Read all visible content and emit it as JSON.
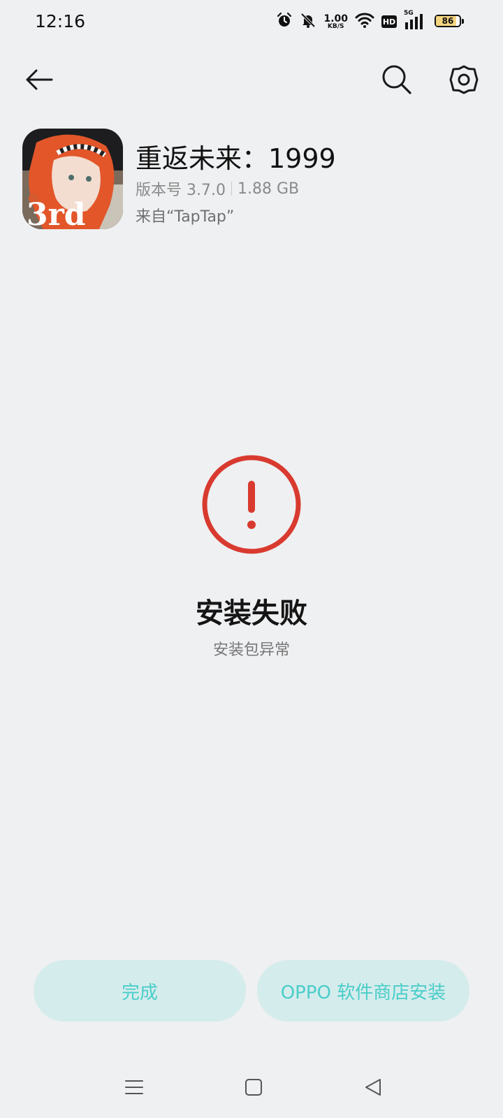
{
  "status_bar": {
    "time": "12:16",
    "net_speed_value": "1.00",
    "net_speed_unit": "KB/S",
    "hd_label": "HD",
    "signal_label": "5G",
    "battery_level": "86",
    "icons": [
      "alarm-icon",
      "bell-muted-icon",
      "wifi-icon",
      "signal-icon",
      "battery-icon"
    ]
  },
  "toolbar": {
    "icons": [
      "back-arrow-icon",
      "search-icon",
      "gear-icon"
    ]
  },
  "app": {
    "name": "重返未来：1999",
    "version": "版本号 3.7.0",
    "size": "1.88 GB",
    "source": "来自“TapTap”",
    "icon_text": "3rd"
  },
  "result": {
    "title": "安装失败",
    "subtitle": "安装包异常",
    "icon": "error-icon",
    "color": "#d93a2f"
  },
  "actions": {
    "done_label": "完成",
    "oppo_label": "OPPO 软件商店安装"
  },
  "nav": {
    "icons": [
      "menu-icon",
      "home-icon",
      "back-icon"
    ]
  },
  "colors": {
    "background": "#eff0f2",
    "button_bg": "#d5ecec",
    "button_text": "#4acdc9",
    "error": "#d93a2f"
  }
}
